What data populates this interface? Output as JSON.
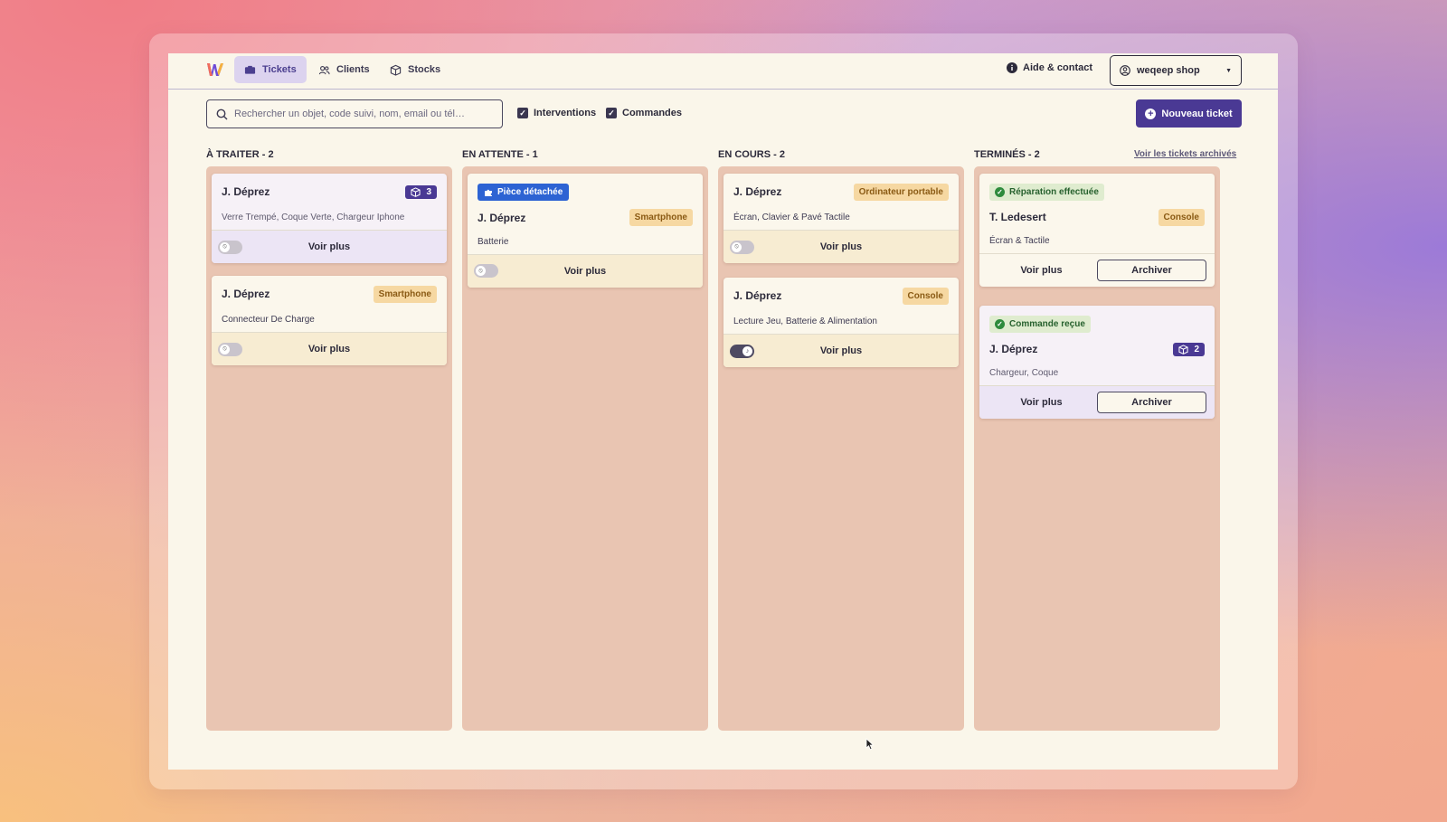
{
  "nav": {
    "tickets": "Tickets",
    "clients": "Clients",
    "stocks": "Stocks",
    "help": "Aide & contact",
    "shop": "weqeep shop"
  },
  "toolbar": {
    "search_placeholder": "Rechercher un objet, code suivi, nom, email ou tél…",
    "filter_interventions": "Interventions",
    "filter_commandes": "Commandes",
    "new_ticket": "Nouveau ticket"
  },
  "columns": [
    {
      "title": "À TRAITER - 2",
      "cards": [
        {
          "name": "J. Déprez",
          "count": "3",
          "items": "Verre Trempé, Coque Verte, Chargeur Iphone",
          "action": "Voir plus"
        },
        {
          "name": "J. Déprez",
          "tag": "Smartphone",
          "items": "Connecteur De Charge",
          "action": "Voir plus"
        }
      ]
    },
    {
      "title": "EN ATTENTE - 1",
      "cards": [
        {
          "badge": "Pièce détachée",
          "name": "J. Déprez",
          "tag": "Smartphone",
          "items": "Batterie",
          "action": "Voir plus"
        }
      ]
    },
    {
      "title": "EN COURS - 2",
      "cards": [
        {
          "name": "J. Déprez",
          "tag": "Ordinateur portable",
          "items": "Écran, Clavier & Pavé Tactile",
          "action": "Voir plus"
        },
        {
          "name": "J. Déprez",
          "tag": "Console",
          "items": "Lecture Jeu, Batterie & Alimentation",
          "action": "Voir plus"
        }
      ]
    },
    {
      "title": "TERMINÉS - 2",
      "link": "Voir les tickets archivés",
      "cards": [
        {
          "status": "Réparation effectuée",
          "name": "T. Ledesert",
          "tag": "Console",
          "items": "Écran & Tactile",
          "action": "Voir plus",
          "archive": "Archiver"
        },
        {
          "status": "Commande reçue",
          "name": "J. Déprez",
          "count": "2",
          "items": "Chargeur, Coque",
          "action": "Voir plus",
          "archive": "Archiver"
        }
      ]
    }
  ]
}
